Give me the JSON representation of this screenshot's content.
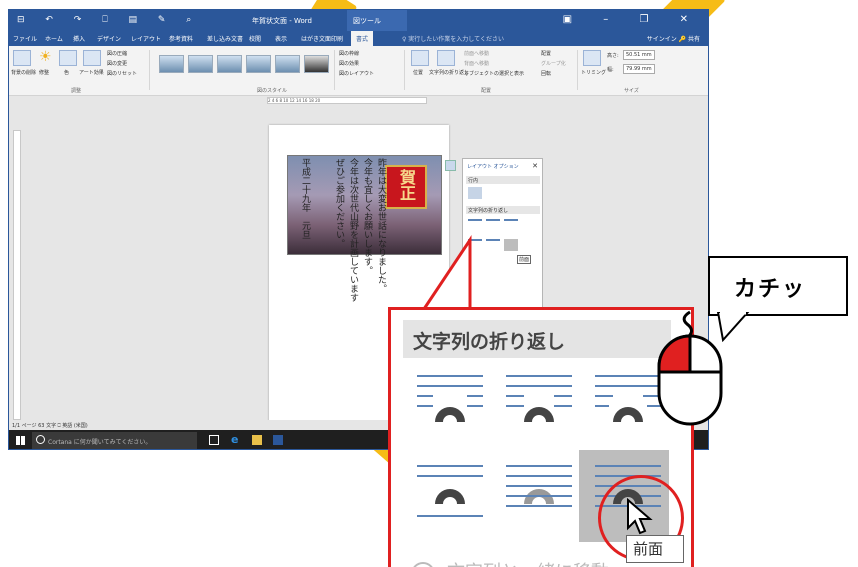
{
  "window": {
    "qat": "⊟ ↶ ↷ ⎕ ▤ ✎ ⌕",
    "title": "年賀状文面 - Word",
    "context_tab": "図ツール",
    "controls": "▣ – ❐ ✕"
  },
  "tabs": [
    "ファイル",
    "ホーム",
    "挿入",
    "デザイン",
    "レイアウト",
    "参考資料",
    "差し込み文書",
    "校閲",
    "表示",
    "はがき文面印刷",
    "書式"
  ],
  "active_tab": "書式",
  "tell_me": "♀ 実行したい作業を入力してください",
  "sign_in": "サインイン  🔑 共有",
  "ribbon": {
    "remove_bg": "背景の削除",
    "corrections": "修整",
    "color": "色",
    "artistic": "アート効果",
    "compress": "図の圧縮",
    "change": "図の変更",
    "reset": "図のリセット",
    "adjust_group": "調整",
    "styles_group": "図のスタイル",
    "border": "図の枠線",
    "effects": "図の効果",
    "layout": "図のレイアウト",
    "position": "位置",
    "wrap_text": "文字列の折り返し",
    "bring_forward": "前面へ移動",
    "send_backward": "背面へ移動",
    "selection_pane": "オブジェクトの選択と表示",
    "align": "配置",
    "group": "グループ化",
    "rotate": "回転",
    "arrange_group": "配置",
    "crop": "トリミング",
    "height_label": "高さ:",
    "height_value": "50.51 mm",
    "width_label": "幅:",
    "width_value": "79.99 mm",
    "size_group": "サイズ"
  },
  "ruler_ticks": "2  4  6  8  10  12  14  16  18  20",
  "document": {
    "badge": "賀正",
    "line1": "昨年は大変お世話になりました。",
    "line2": "今年も宜しくお願いします。",
    "line3": "今年は次世代山野を計画しています",
    "line4": "ぜひご参加ください。",
    "date": "平成二十九年　元旦"
  },
  "layout_panel": {
    "title": "レイアウト オプション",
    "close": "✕",
    "inline_section": "行内",
    "wrap_section": "文字列の折り返し",
    "tooltip": "前面"
  },
  "status": "1/1 ページ   63 文字   ⎕   英語 (米国)",
  "taskbar": {
    "search": "Cortana に何か聞いてみてください。"
  },
  "zoom": {
    "section_title": "文字列の折り返し",
    "tooltip": "前面",
    "radio_text": "文字列と一緒に移動"
  },
  "bubble": {
    "text": "カチッ"
  },
  "colors": {
    "word_blue": "#2b579a",
    "highlight_red": "#e02020",
    "stroke_yellow": "#f6bc16"
  }
}
